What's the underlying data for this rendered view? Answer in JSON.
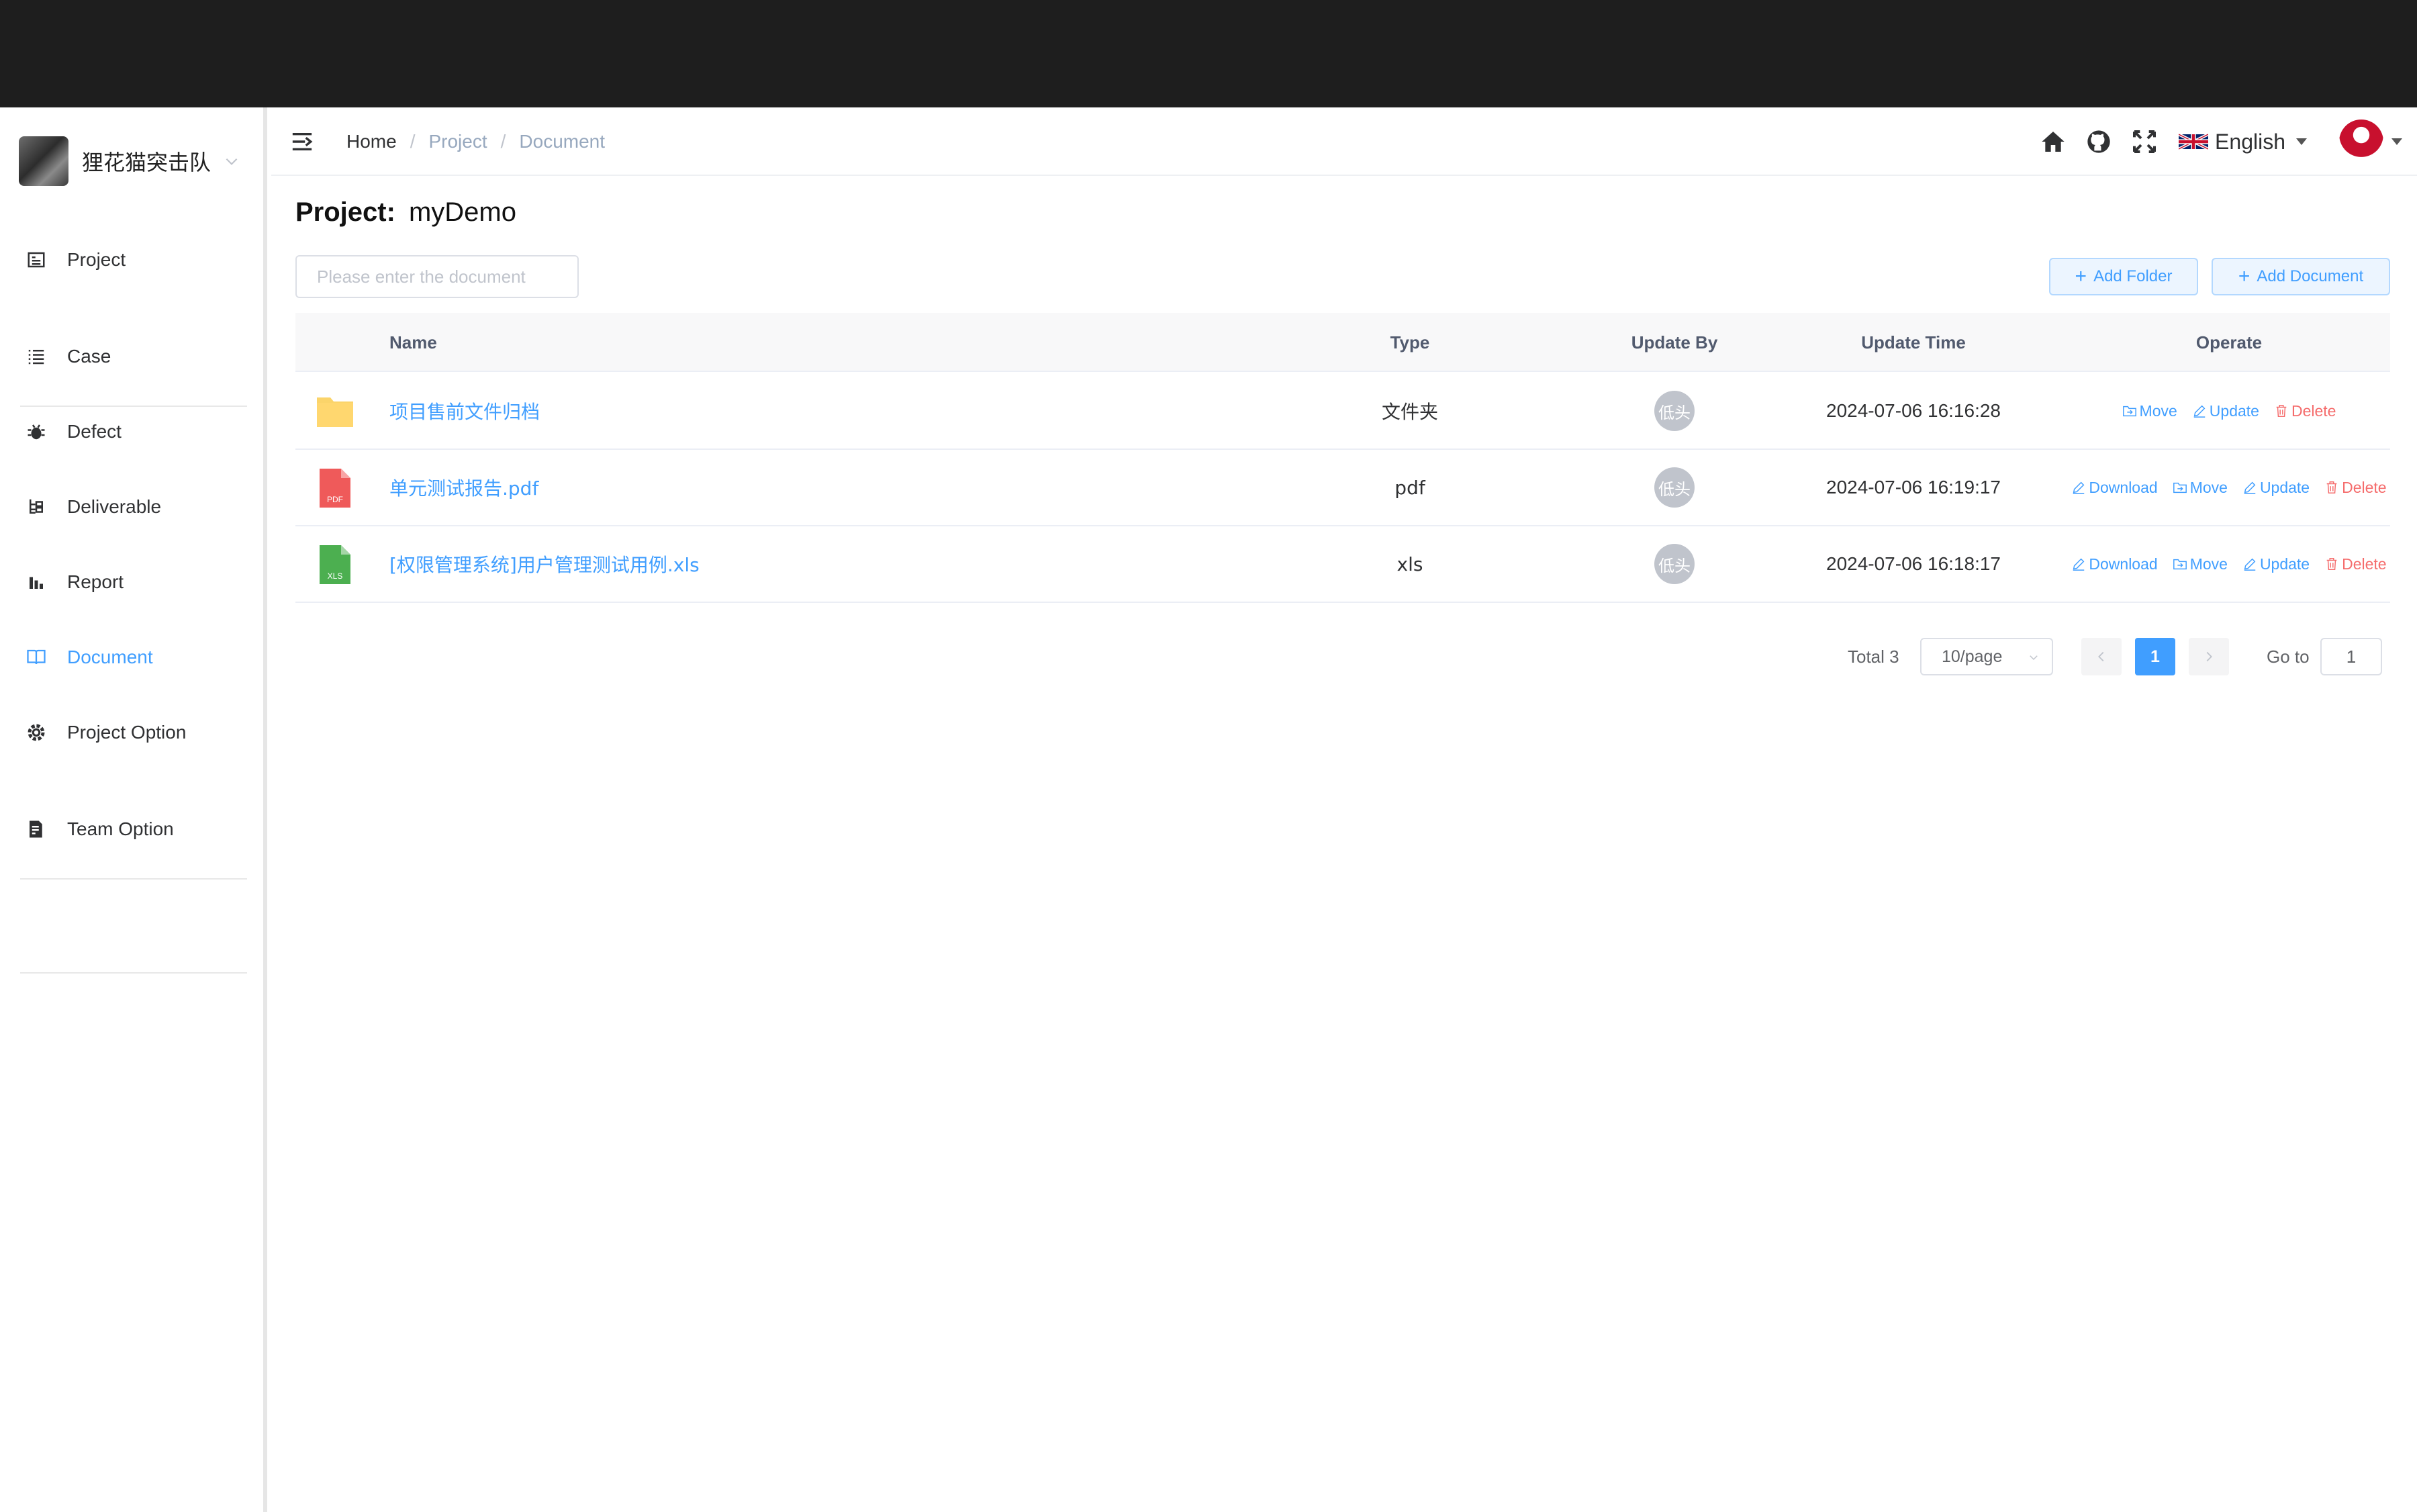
{
  "sidebar": {
    "team_name": "狸花猫突击队",
    "items": [
      {
        "label": "Project",
        "icon": "project-icon"
      },
      {
        "label": "Case",
        "icon": "list-icon"
      },
      {
        "label": "Defect",
        "icon": "bug-icon"
      },
      {
        "label": "Deliverable",
        "icon": "tree-icon"
      },
      {
        "label": "Report",
        "icon": "bar-chart-icon"
      },
      {
        "label": "Document",
        "icon": "book-icon",
        "active": true
      },
      {
        "label": "Project Option",
        "icon": "gear-icon"
      },
      {
        "label": "Team Option",
        "icon": "edit-doc-icon"
      }
    ]
  },
  "navbar": {
    "breadcrumb": [
      "Home",
      "Project",
      "Document"
    ],
    "language": "English"
  },
  "page": {
    "project_label": "Project:",
    "project_name": "myDemo",
    "search_placeholder": "Please enter the document",
    "add_folder": "Add Folder",
    "add_document": "Add Document"
  },
  "table": {
    "columns": {
      "name": "Name",
      "type": "Type",
      "update_by": "Update By",
      "update_time": "Update Time",
      "operate": "Operate"
    },
    "rows": [
      {
        "name": "项目售前文件归档",
        "type": "文件夹",
        "update_by": "低头",
        "update_time": "2024-07-06 16:16:28",
        "icon": "folder-icon"
      },
      {
        "name": "单元测试报告.pdf",
        "type": "pdf",
        "update_by": "低头",
        "update_time": "2024-07-06 16:19:17",
        "icon": "pdf-file-icon",
        "icon_text": "PDF"
      },
      {
        "name": "[权限管理系统]用户管理测试用例.xls",
        "type": "xls",
        "update_by": "低头",
        "update_time": "2024-07-06 16:18:17",
        "icon": "xls-file-icon",
        "icon_text": "XLS"
      }
    ],
    "ops": {
      "download": "Download",
      "move": "Move",
      "update": "Update",
      "delete": "Delete"
    }
  },
  "pagination": {
    "total": "Total 3",
    "page_size": "10/page",
    "current_page": "1",
    "goto_label": "Go to",
    "goto_value": "1"
  },
  "colors": {
    "primary": "#409eff",
    "danger": "#f56c6c",
    "topbar": "#1e1e1e"
  }
}
